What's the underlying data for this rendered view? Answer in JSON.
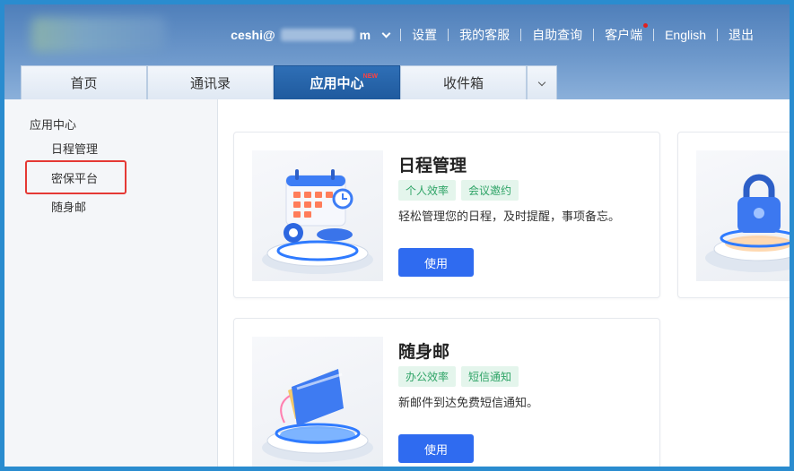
{
  "header": {
    "user": {
      "prefix": "ceshi@",
      "suffix": "m"
    },
    "links": [
      "设置",
      "我的客服",
      "自助查询",
      "客户端",
      "English",
      "退出"
    ]
  },
  "tabs": [
    {
      "label": "首页",
      "active": false
    },
    {
      "label": "通讯录",
      "active": false
    },
    {
      "label": "应用中心",
      "active": true,
      "badge": "NEW"
    },
    {
      "label": "收件箱",
      "active": false
    }
  ],
  "sidebar": {
    "group": "应用中心",
    "items": [
      "日程管理",
      "密保平台",
      "随身邮"
    ]
  },
  "cards": [
    {
      "title": "日程管理",
      "tags": [
        "个人效率",
        "会议邀约"
      ],
      "desc": "轻松管理您的日程，及时提醒，事项备忘。",
      "button": "使用",
      "icon": "calendar-illustration"
    },
    {
      "title": "随身邮",
      "tags": [
        "办公效率",
        "短信通知"
      ],
      "desc": "新邮件到达免费短信通知。",
      "button": "使用",
      "icon": "wallet-illustration"
    }
  ],
  "colors": {
    "accent": "#2f6bf0",
    "header": "#4f7fba",
    "tag_bg": "#e4f5ec",
    "tag_text": "#2fa467",
    "highlight": "#e53935"
  }
}
